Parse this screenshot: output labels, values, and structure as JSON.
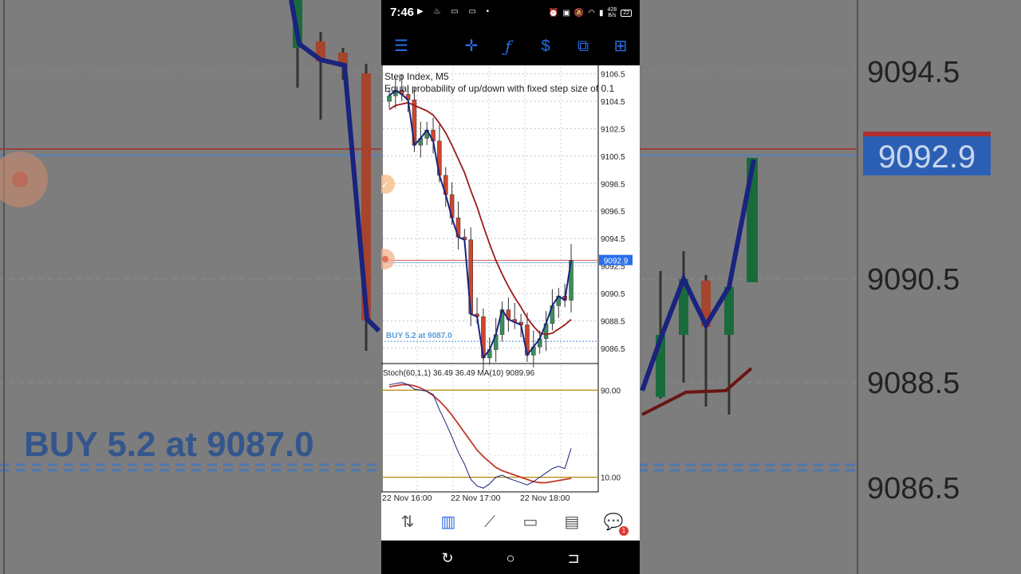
{
  "status_bar": {
    "time": "7:46",
    "left_icons": [
      "youtube-icon",
      "fire-icon",
      "chat-icon",
      "chat-icon",
      "dot-icon"
    ],
    "net_speed_value": "428",
    "net_speed_unit": "B/s",
    "battery": "22"
  },
  "toolbar": {
    "items": [
      "menu-icon",
      "crosshair-icon",
      "function-icon",
      "trade-icon",
      "windows-icon",
      "new-order-icon"
    ]
  },
  "chart": {
    "symbol_line": "Step Index, M5",
    "description_line": "Equal probability of up/down with fixed step size of 0.1",
    "price_labels": [
      "9106.5",
      "9104.5",
      "9102.5",
      "9100.5",
      "9098.5",
      "9096.5",
      "9094.5",
      "9092.5",
      "9090.5",
      "9088.5",
      "9086.5"
    ],
    "current_price": "9092.9",
    "position_label": "BUY 5.2 at 9087.0",
    "indicator_label": "Stoch(60,1,1) 36.49 36.49 MA(10) 9089.96",
    "indicator_levels": [
      "90.00",
      "10.00"
    ],
    "time_labels": [
      "22 Nov 16:00",
      "22 Nov 17:00",
      "22 Nov 18:00"
    ],
    "colors": {
      "bull": "#3a8f5a",
      "bear": "#d0452c",
      "zigzag": "#1a237e",
      "ma": "#9b1b1b",
      "price_tag": "#2a6ee8",
      "buy_line": "#5b9bd5",
      "level_line": "#b8860b"
    }
  },
  "chart_data": {
    "type": "candlestick",
    "symbol": "Step Index",
    "timeframe": "M5",
    "ylim": [
      9085.5,
      9107.0
    ],
    "close": [
      9104.9,
      9105.3,
      9105.0,
      9104.6,
      9101.3,
      9101.8,
      9102.4,
      9101.6,
      9099.1,
      9097.7,
      9096.0,
      9094.6,
      9094.4,
      9089.0,
      9088.8,
      9085.8,
      9086.4,
      9087.5,
      9089.3,
      9088.6,
      9088.4,
      9088.2,
      9086.0,
      9086.6,
      9087.2,
      9088.3,
      9089.6,
      9090.3,
      9090.0,
      9092.9
    ],
    "ma": [
      9103.9,
      9104.2,
      9104.3,
      9104.4,
      9104.2,
      9104.0,
      9103.8,
      9103.5,
      9102.9,
      9102.2,
      9101.3,
      9100.3,
      9099.3,
      9098.0,
      9096.8,
      9095.4,
      9094.1,
      9092.9,
      9091.9,
      9091.0,
      9090.2,
      9089.5,
      9088.7,
      9088.1,
      9087.6,
      9087.5,
      9087.6,
      9087.9,
      9088.2,
      9088.6
    ],
    "stoch_main": [
      95,
      96,
      97,
      95,
      91,
      90,
      89,
      86,
      72,
      60,
      47,
      33,
      22,
      8,
      2,
      0,
      4,
      10,
      12,
      9,
      7,
      5,
      3,
      6,
      10,
      14,
      18,
      20,
      18,
      36.49
    ],
    "stoch_ma": [
      93,
      94,
      95,
      95,
      94,
      92,
      89,
      85,
      80,
      74,
      67,
      59,
      51,
      43,
      35,
      29,
      24,
      19,
      16,
      14,
      12,
      10,
      8,
      6,
      5,
      5,
      6,
      7,
      8,
      9
    ],
    "stoch_levels": [
      90,
      10
    ],
    "position": {
      "side": "BUY",
      "volume": 5.2,
      "price": 9087.0
    },
    "current_price": 9092.9
  },
  "bottom_nav": {
    "items": [
      "quotes-icon",
      "chart-icon",
      "trade-icon",
      "history-icon",
      "news-icon",
      "messages-icon"
    ],
    "active": "chart-icon",
    "messages_badge": "1"
  },
  "system_nav": [
    "recent-apps-icon",
    "home-icon",
    "back-icon"
  ]
}
